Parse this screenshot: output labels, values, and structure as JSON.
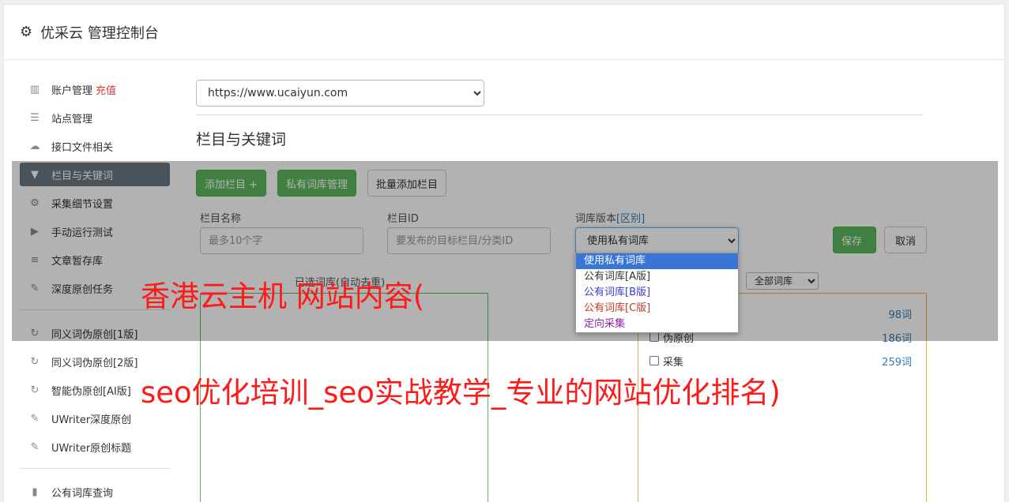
{
  "header": {
    "title": "优采云 管理控制台"
  },
  "sidebar": {
    "items": [
      {
        "label": "账户管理",
        "extra": "充值"
      },
      {
        "label": "站点管理"
      },
      {
        "label": "接口文件相关"
      },
      {
        "label": "栏目与关键词"
      },
      {
        "label": "采集细节设置"
      },
      {
        "label": "手动运行测试"
      },
      {
        "label": "文章暂存库"
      },
      {
        "label": "深度原创任务"
      },
      {
        "label": "同义词伪原创[1版]"
      },
      {
        "label": "同义词伪原创[2版]"
      },
      {
        "label": "智能伪原创[AI版]"
      },
      {
        "label": "UWriter深度原创"
      },
      {
        "label": "UWriter原创标题"
      },
      {
        "label": "公有词库查询"
      }
    ]
  },
  "main": {
    "site_url": "https://www.ucaiyun.com",
    "section_title": "栏目与关键词",
    "buttons": {
      "add_column": "添加栏目 +",
      "private_lib": "私有词库管理",
      "batch_add": "批量添加栏目"
    },
    "form": {
      "column_name_label": "栏目名称",
      "column_name_placeholder": "最多10个字",
      "column_id_label": "栏目ID",
      "column_id_placeholder": "要发布的目标栏目/分类ID",
      "lib_version_label": "词库版本",
      "lib_version_link": "[区别]",
      "lib_version_value": "使用私有词库",
      "save": "保存",
      "cancel": "取消"
    },
    "dropdown_options": [
      "使用私有词库",
      "公有词库[A版]",
      "公有词库[B版]",
      "公有词库[C版]",
      "定向采集"
    ],
    "chosen_label": "已选词库(自动去重)",
    "filter_value": "全部词库",
    "libraries": [
      {
        "name": "",
        "count": "98词"
      },
      {
        "name": "伪原创",
        "count": "186词"
      },
      {
        "name": "采集",
        "count": "259词"
      }
    ]
  },
  "watermark": {
    "line1": "香港云主机 网站内容(",
    "line2": "seo优化培训_seo实战教学_专业的网站优化排名)"
  }
}
